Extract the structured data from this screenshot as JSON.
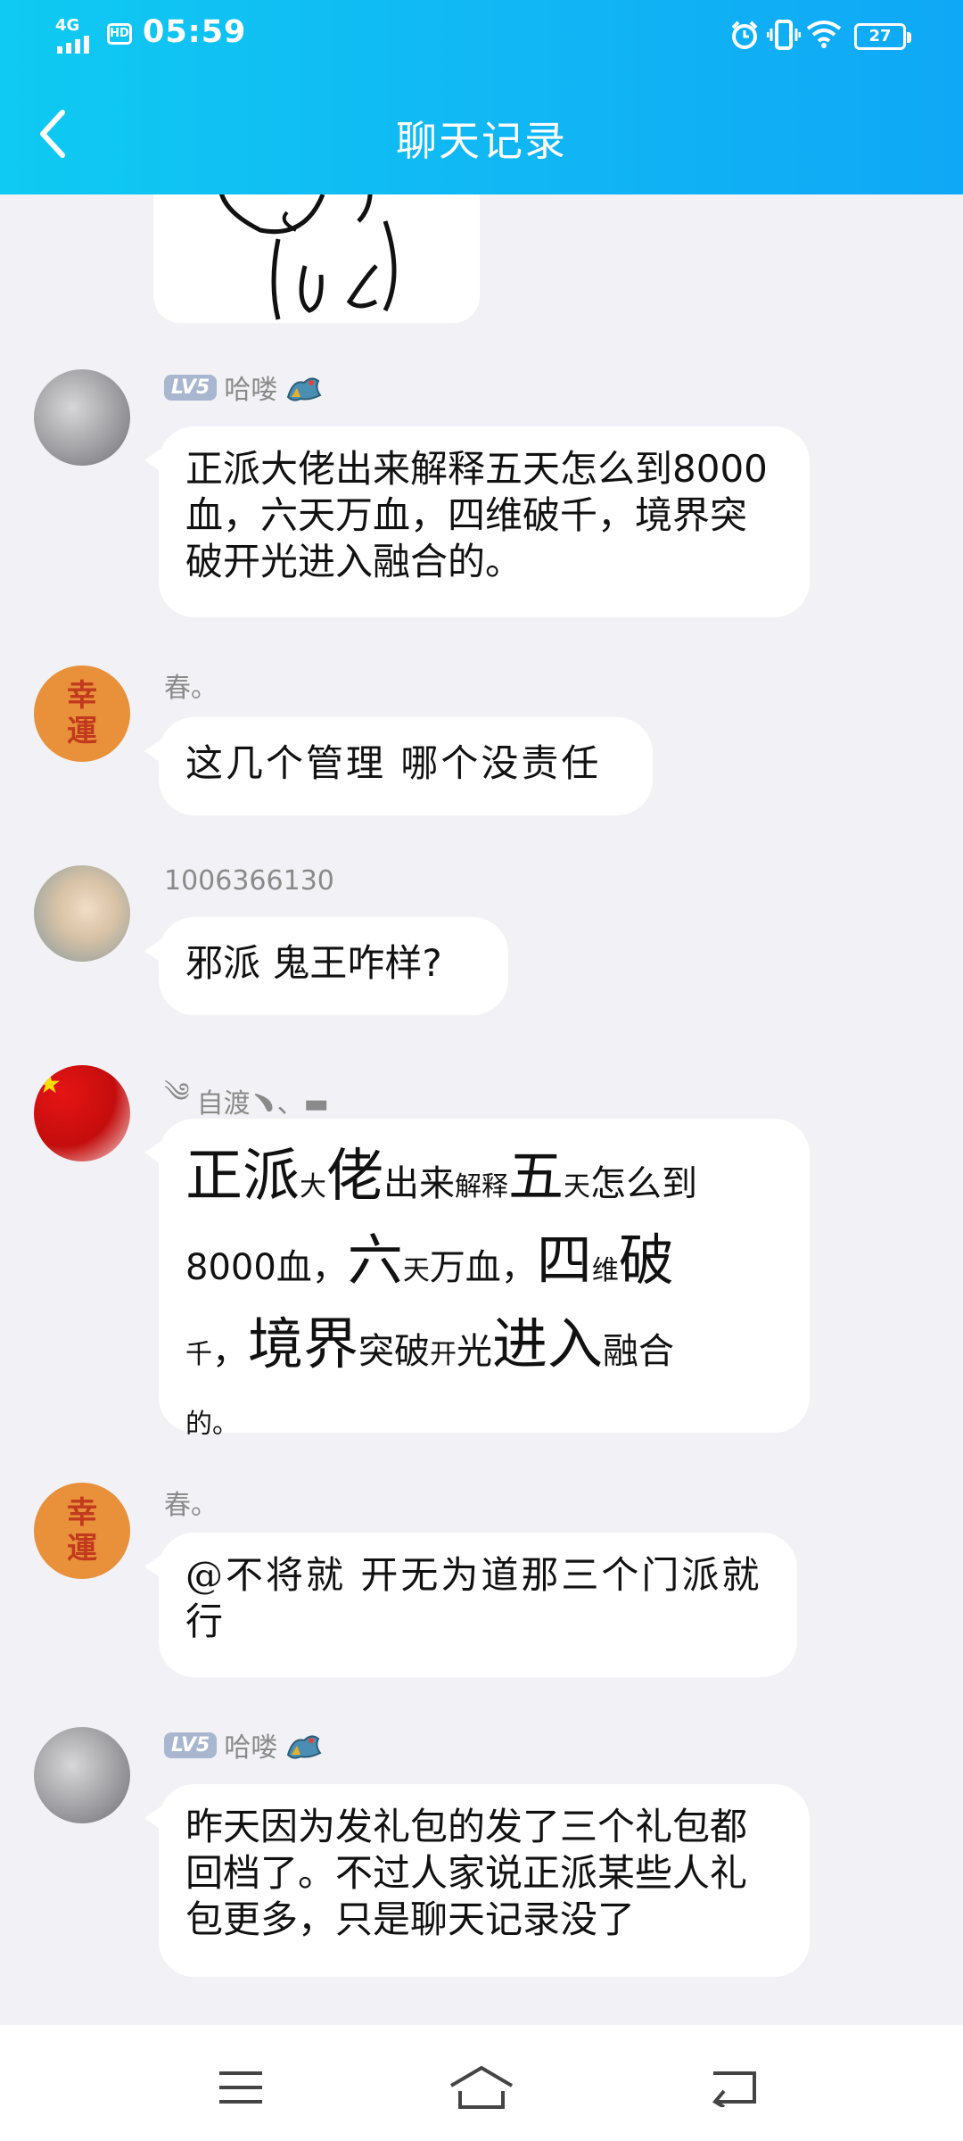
{
  "status_bar": {
    "network": "4G",
    "hd": "HD",
    "time": "05:59",
    "battery": "27"
  },
  "header": {
    "title": "聊天记录"
  },
  "messages": [
    {
      "sender": "哈喽",
      "level": "LV5",
      "text": "正派大佬出来解释五天怎么到8000血，六天万血，四维破千，境界突破开光进入融合的。"
    },
    {
      "sender": "春。",
      "avatar_text": [
        "幸",
        "運"
      ],
      "text": "这几个管理  哪个没责任"
    },
    {
      "sender": "1006366130",
      "text": "邪派 鬼王咋样?"
    },
    {
      "sender": "自渡﹅、▬",
      "sender_prefix": "༄",
      "text_parts": [
        "正派",
        "大",
        "佬",
        "出来",
        "解释",
        "五",
        "天",
        "怎么到",
        "8000血，",
        "六",
        "天",
        "万血，",
        "四",
        "维",
        "破",
        "千",
        "，",
        "境界",
        "突破",
        "开",
        "光",
        "进入",
        "融合",
        "的。"
      ]
    },
    {
      "sender": "春。",
      "avatar_text": [
        "幸",
        "運"
      ],
      "text": "@不将就 开无为道那三个门派就行"
    },
    {
      "sender": "哈喽",
      "level": "LV5",
      "text": "昨天因为发礼包的发了三个礼包都回档了。不过人家说正派某些人礼包更多，只是聊天记录没了"
    }
  ],
  "colors": {
    "header_start": "#0fcaf2",
    "header_end": "#0fa8f6",
    "background": "#f2f2f6",
    "bubble": "#ffffff"
  },
  "icons": {
    "back": "chevron-left-icon",
    "menu": "menu-icon",
    "home": "home-icon",
    "nav_back": "return-icon"
  }
}
